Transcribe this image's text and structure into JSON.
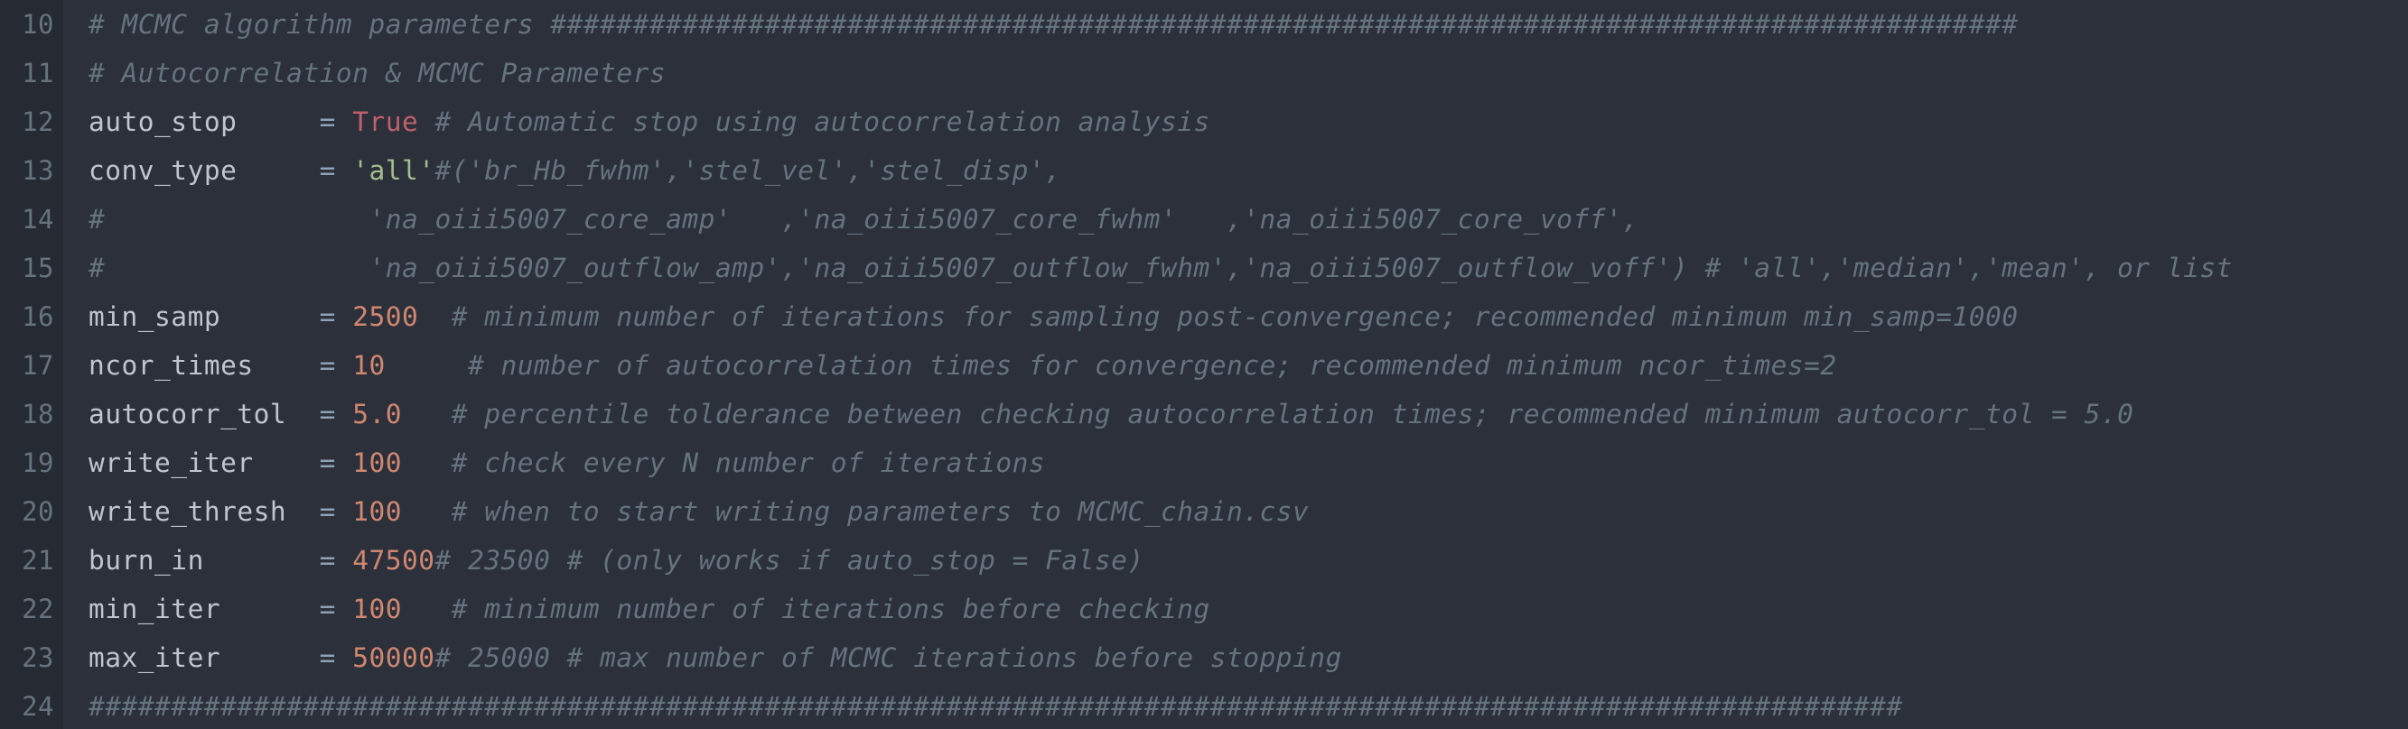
{
  "editor": {
    "colors": {
      "background": "#2b303b",
      "gutter": "#262a33",
      "comment": "#65737e",
      "operator": "#8fa1b3",
      "number": "#d08770",
      "boolean": "#bf616a",
      "string": "#a3be8c",
      "identifier": "#c0c5ce"
    },
    "lines": [
      {
        "n": "10",
        "tokens": [
          {
            "t": "cm",
            "v": "# MCMC algorithm parameters #########################################################################################"
          }
        ]
      },
      {
        "n": "11",
        "tokens": [
          {
            "t": "cm",
            "v": "# Autocorrelation & MCMC Parameters"
          }
        ]
      },
      {
        "n": "12",
        "tokens": [
          {
            "t": "id",
            "v": "auto_stop     "
          },
          {
            "t": "op",
            "v": "= "
          },
          {
            "t": "bool",
            "v": "True"
          },
          {
            "t": "cm",
            "v": " # Automatic stop using autocorrelation analysis"
          }
        ]
      },
      {
        "n": "13",
        "tokens": [
          {
            "t": "id",
            "v": "conv_type     "
          },
          {
            "t": "op",
            "v": "= "
          },
          {
            "t": "str",
            "v": "'all'"
          },
          {
            "t": "cm",
            "v": "#('br_Hb_fwhm','stel_vel','stel_disp',"
          }
        ]
      },
      {
        "n": "14",
        "tokens": [
          {
            "t": "cm",
            "v": "#                'na_oiii5007_core_amp'   ,'na_oiii5007_core_fwhm'   ,'na_oiii5007_core_voff',"
          }
        ]
      },
      {
        "n": "15",
        "tokens": [
          {
            "t": "cm",
            "v": "#                'na_oiii5007_outflow_amp','na_oiii5007_outflow_fwhm','na_oiii5007_outflow_voff') # 'all','median','mean', or list"
          }
        ]
      },
      {
        "n": "16",
        "tokens": [
          {
            "t": "id",
            "v": "min_samp      "
          },
          {
            "t": "op",
            "v": "= "
          },
          {
            "t": "num",
            "v": "2500"
          },
          {
            "t": "cm",
            "v": "  # minimum number of iterations for sampling post-convergence; recommended minimum min_samp=1000"
          }
        ]
      },
      {
        "n": "17",
        "tokens": [
          {
            "t": "id",
            "v": "ncor_times    "
          },
          {
            "t": "op",
            "v": "= "
          },
          {
            "t": "num",
            "v": "10"
          },
          {
            "t": "cm",
            "v": "     # number of autocorrelation times for convergence; recommended minimum ncor_times=2"
          }
        ]
      },
      {
        "n": "18",
        "tokens": [
          {
            "t": "id",
            "v": "autocorr_tol  "
          },
          {
            "t": "op",
            "v": "= "
          },
          {
            "t": "num",
            "v": "5.0"
          },
          {
            "t": "cm",
            "v": "   # percentile tolderance between checking autocorrelation times; recommended minimum autocorr_tol = 5.0"
          }
        ]
      },
      {
        "n": "19",
        "tokens": [
          {
            "t": "id",
            "v": "write_iter    "
          },
          {
            "t": "op",
            "v": "= "
          },
          {
            "t": "num",
            "v": "100"
          },
          {
            "t": "cm",
            "v": "   # check every N number of iterations"
          }
        ]
      },
      {
        "n": "20",
        "tokens": [
          {
            "t": "id",
            "v": "write_thresh  "
          },
          {
            "t": "op",
            "v": "= "
          },
          {
            "t": "num",
            "v": "100"
          },
          {
            "t": "cm",
            "v": "   # when to start writing parameters to MCMC_chain.csv"
          }
        ]
      },
      {
        "n": "21",
        "tokens": [
          {
            "t": "id",
            "v": "burn_in       "
          },
          {
            "t": "op",
            "v": "= "
          },
          {
            "t": "num",
            "v": "47500"
          },
          {
            "t": "cm",
            "v": "# 23500 # (only works if auto_stop = False)"
          }
        ]
      },
      {
        "n": "22",
        "tokens": [
          {
            "t": "id",
            "v": "min_iter      "
          },
          {
            "t": "op",
            "v": "= "
          },
          {
            "t": "num",
            "v": "100"
          },
          {
            "t": "cm",
            "v": "   # minimum number of iterations before checking"
          }
        ]
      },
      {
        "n": "23",
        "tokens": [
          {
            "t": "id",
            "v": "max_iter      "
          },
          {
            "t": "op",
            "v": "= "
          },
          {
            "t": "num",
            "v": "50000"
          },
          {
            "t": "cm",
            "v": "# 25000 # max number of MCMC iterations before stopping"
          }
        ]
      },
      {
        "n": "24",
        "tokens": [
          {
            "t": "cm",
            "v": "##############################################################################################################"
          }
        ]
      }
    ]
  }
}
